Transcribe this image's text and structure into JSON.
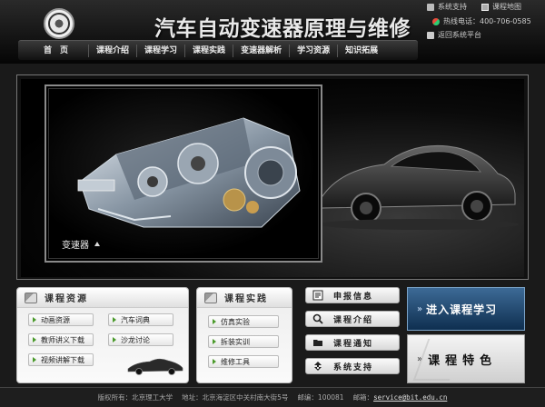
{
  "header": {
    "title": "汽车自动变速器原理与维修",
    "top_links": {
      "support": "系统支持",
      "sitemap": "课程地图",
      "hotline": "热线电话：400-706-0585",
      "return": "返回系统平台"
    }
  },
  "nav": {
    "items": [
      "首　页",
      "课程介绍",
      "课程学习",
      "课程实践",
      "变速器解析",
      "学习资源",
      "知识拓展"
    ]
  },
  "hero": {
    "caption": "变速器"
  },
  "resources": {
    "title": "课程资源",
    "links": [
      "动画资源",
      "汽车词典",
      "教师讲义下载",
      "沙龙讨论",
      "视频讲解下载"
    ]
  },
  "practice": {
    "title": "课程实践",
    "links": [
      "仿真实验",
      "拆装实训",
      "维修工具"
    ]
  },
  "side_menu": {
    "items": [
      {
        "label": "申报信息",
        "icon": "document-icon"
      },
      {
        "label": "课程介绍",
        "icon": "search-icon"
      },
      {
        "label": "课程通知",
        "icon": "folder-icon"
      },
      {
        "label": "系统支持",
        "icon": "refresh-icon"
      }
    ]
  },
  "promo": {
    "enter_arrows": "»",
    "enter": "进入课程学习",
    "feature_arrows": "»",
    "feature": "课程特色"
  },
  "footer": {
    "copyright": "版权所有：北京理工大学",
    "address": "地址：北京海淀区中关村南大街5号",
    "postcode": "邮编：100081",
    "email_label": "邮箱：",
    "email": "service@bit.edu.cn"
  },
  "colors": {
    "header_bg": "#050505",
    "nav_bg": "#2a2a2a",
    "enter_button": "#1f4a73",
    "panel_bg": "#f2f2f2"
  }
}
